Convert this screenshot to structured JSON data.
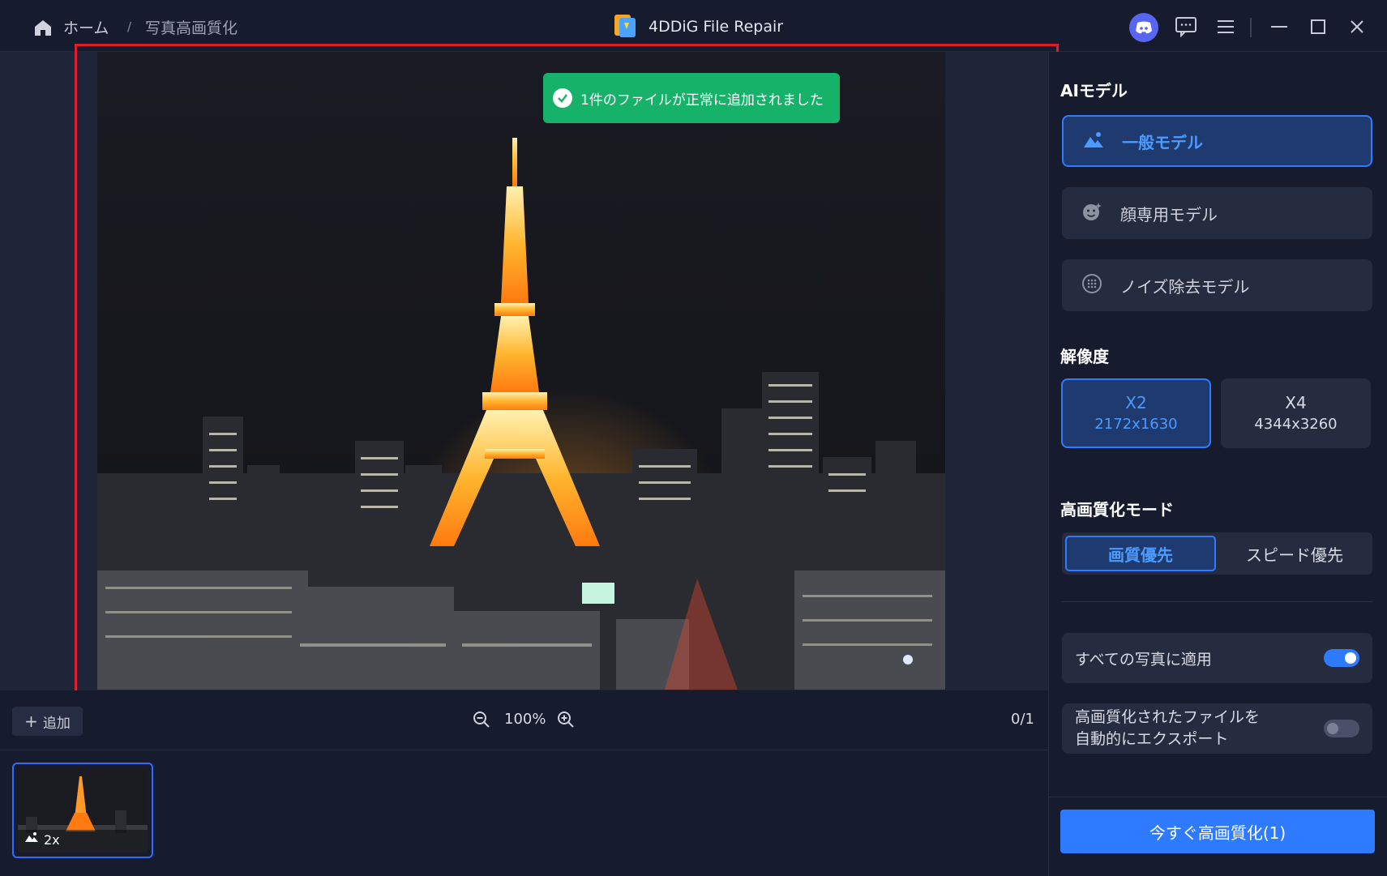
{
  "breadcrumb": {
    "home": "ホーム",
    "separator": "/",
    "current": "写真高画質化"
  },
  "window": {
    "title": "4DDiG File Repair"
  },
  "toast": {
    "message": "1件のファイルが正常に追加されました"
  },
  "toolbar": {
    "add_label": "追加",
    "zoom_level": "100%",
    "page_counter": "0/1"
  },
  "thumbnail": {
    "badge": "2x"
  },
  "panel": {
    "ai_model_heading": "AIモデル",
    "models": [
      {
        "label": "一般モデル",
        "icon": "landscape-icon",
        "selected": true
      },
      {
        "label": "顔専用モデル",
        "icon": "face-icon",
        "selected": false
      },
      {
        "label": "ノイズ除去モデル",
        "icon": "noise-icon",
        "selected": false
      }
    ],
    "resolution_heading": "解像度",
    "resolutions": [
      {
        "scale": "X2",
        "size": "2172x1630",
        "selected": true
      },
      {
        "scale": "X4",
        "size": "4344x3260",
        "selected": false
      }
    ],
    "mode_heading": "高画質化モード",
    "modes": [
      {
        "label": "画質優先",
        "selected": true
      },
      {
        "label": "スピード優先",
        "selected": false
      }
    ],
    "apply_all_label": "すべての写真に適用",
    "apply_all_on": true,
    "auto_export_line1": "高画質化されたファイルを",
    "auto_export_line2": "自動的にエクスポート",
    "auto_export_on": false,
    "cta_label": "今すぐ高画質化(1)"
  },
  "colors": {
    "accent": "#2f7bff",
    "toast": "#17b26a",
    "highlight_box": "#e11d2a",
    "background": "#161b2e"
  }
}
